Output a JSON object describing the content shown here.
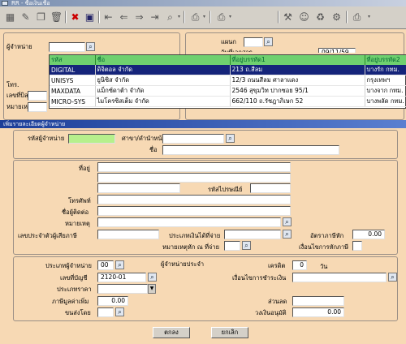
{
  "window": {
    "title": "RR - ซื้อเงินเชื่อ"
  },
  "toolbar": {
    "icons": [
      "grid-icon",
      "edit-icon",
      "copy-icon",
      "delete-icon",
      "close-icon",
      "save-icon",
      "first-icon",
      "prev-icon",
      "next-icon",
      "last-icon",
      "search-icon",
      "print-icon",
      "preview-icon",
      "tools-icon",
      "user-icon",
      "refresh-icon",
      "settings-icon",
      "print-menu-icon"
    ]
  },
  "background_form": {
    "supplier_label": "ผู้จำหน่าย",
    "tax_label": "โทร.",
    "doc_no_label": "เลขที่บิล",
    "note_label": "หมายเหตุ",
    "right_label_1": "แผนก",
    "right_label_2": "วันที่เอกสาร",
    "right_date": "09/11/59"
  },
  "lookup_grid": {
    "columns": [
      "รหัส",
      "ชื่อ",
      "ที่อยู่บรรทัด1",
      "ที่อยู่บรรทัด2"
    ],
    "rows": [
      [
        "DIGITAL",
        "ดิจิตอล จำกัด",
        "213 ถ.สีลม",
        "บางรัก กทม."
      ],
      [
        "UNISYS",
        "ยูนิซิส จำกัด",
        "12/3 ถนนสีลม ศาลาแดง",
        "กรุงเทพฯ"
      ],
      [
        "MAXDATA",
        "แม็กซ์ดาต้า จำกัด",
        "2546 สุขุมวิท ปากซอย 95/1",
        "บางจาก กทม."
      ],
      [
        "MICRO-SYS",
        "ไมโครซิสเต็ม จำกัด",
        "662/110 ถ.รัชฎาภิเษก 52",
        "บางพลัด กทม."
      ]
    ],
    "selected_row": 0
  },
  "dialog": {
    "title": "เพิ่มรายละเอียดผู้จำหน่าย",
    "code_label": "รหัสผู้จำหน่าย",
    "code_value": "",
    "branch_label": "ศาขา/คำนำหน้าชื่อ",
    "name_label": "ชื่อ",
    "address_label": "ที่อยู่",
    "postal_label": "รหัสไปรษณีย์",
    "phone_label": "โทรศัพท์",
    "contact_label": "ชื่อผู้ติดต่อ",
    "note_label": "หมายเหตุ",
    "taxid_label": "เลขประจำตัวผู้เสียภาษี",
    "paytype_label": "ประเภทเงินได้ที่จ่าย",
    "withholding_label": "อัตราภาษีหัก",
    "withholding_value": "0.00",
    "withholding_note_label": "หมายเหตุหัก ณ ที่จ่าย",
    "tax_condition_label": "เงื่อนไขการหักภาษี",
    "supplier_type_label": "ประเภทผู้จำหน่าย",
    "supplier_type_value": "00",
    "supplier_section_label": "ผู้จำหน่ายประจำ",
    "credit_label": "เครดิต",
    "credit_value": "0",
    "credit_unit": "วัน",
    "account_label": "เลขที่บัญชี",
    "account_value": "2120-01",
    "payment_condition_label": "เงื่อนไขการชำระเงิน",
    "price_type_label": "ประเภทราคา",
    "vat_label": "ภาษีมูลค่าเพิ่ม",
    "vat_value": "0.00",
    "discount_label": "ส่วนลด",
    "shipping_label": "ขนส่งโดย",
    "credit_limit_label": "วงเงินอนุมัติ",
    "credit_limit_value": "0.00",
    "ok_button": "ตกลง",
    "cancel_button": "ยกเลิก"
  }
}
